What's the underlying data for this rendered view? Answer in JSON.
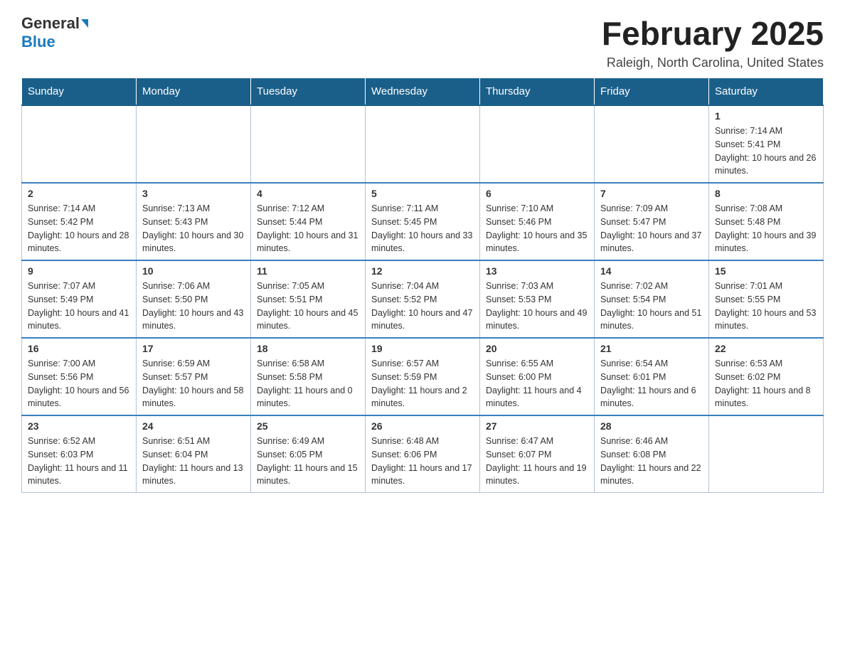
{
  "header": {
    "logo_general": "General",
    "logo_blue": "Blue",
    "month_title": "February 2025",
    "location": "Raleigh, North Carolina, United States"
  },
  "days_of_week": [
    "Sunday",
    "Monday",
    "Tuesday",
    "Wednesday",
    "Thursday",
    "Friday",
    "Saturday"
  ],
  "weeks": [
    [
      {
        "day": "",
        "info": ""
      },
      {
        "day": "",
        "info": ""
      },
      {
        "day": "",
        "info": ""
      },
      {
        "day": "",
        "info": ""
      },
      {
        "day": "",
        "info": ""
      },
      {
        "day": "",
        "info": ""
      },
      {
        "day": "1",
        "info": "Sunrise: 7:14 AM\nSunset: 5:41 PM\nDaylight: 10 hours and 26 minutes."
      }
    ],
    [
      {
        "day": "2",
        "info": "Sunrise: 7:14 AM\nSunset: 5:42 PM\nDaylight: 10 hours and 28 minutes."
      },
      {
        "day": "3",
        "info": "Sunrise: 7:13 AM\nSunset: 5:43 PM\nDaylight: 10 hours and 30 minutes."
      },
      {
        "day": "4",
        "info": "Sunrise: 7:12 AM\nSunset: 5:44 PM\nDaylight: 10 hours and 31 minutes."
      },
      {
        "day": "5",
        "info": "Sunrise: 7:11 AM\nSunset: 5:45 PM\nDaylight: 10 hours and 33 minutes."
      },
      {
        "day": "6",
        "info": "Sunrise: 7:10 AM\nSunset: 5:46 PM\nDaylight: 10 hours and 35 minutes."
      },
      {
        "day": "7",
        "info": "Sunrise: 7:09 AM\nSunset: 5:47 PM\nDaylight: 10 hours and 37 minutes."
      },
      {
        "day": "8",
        "info": "Sunrise: 7:08 AM\nSunset: 5:48 PM\nDaylight: 10 hours and 39 minutes."
      }
    ],
    [
      {
        "day": "9",
        "info": "Sunrise: 7:07 AM\nSunset: 5:49 PM\nDaylight: 10 hours and 41 minutes."
      },
      {
        "day": "10",
        "info": "Sunrise: 7:06 AM\nSunset: 5:50 PM\nDaylight: 10 hours and 43 minutes."
      },
      {
        "day": "11",
        "info": "Sunrise: 7:05 AM\nSunset: 5:51 PM\nDaylight: 10 hours and 45 minutes."
      },
      {
        "day": "12",
        "info": "Sunrise: 7:04 AM\nSunset: 5:52 PM\nDaylight: 10 hours and 47 minutes."
      },
      {
        "day": "13",
        "info": "Sunrise: 7:03 AM\nSunset: 5:53 PM\nDaylight: 10 hours and 49 minutes."
      },
      {
        "day": "14",
        "info": "Sunrise: 7:02 AM\nSunset: 5:54 PM\nDaylight: 10 hours and 51 minutes."
      },
      {
        "day": "15",
        "info": "Sunrise: 7:01 AM\nSunset: 5:55 PM\nDaylight: 10 hours and 53 minutes."
      }
    ],
    [
      {
        "day": "16",
        "info": "Sunrise: 7:00 AM\nSunset: 5:56 PM\nDaylight: 10 hours and 56 minutes."
      },
      {
        "day": "17",
        "info": "Sunrise: 6:59 AM\nSunset: 5:57 PM\nDaylight: 10 hours and 58 minutes."
      },
      {
        "day": "18",
        "info": "Sunrise: 6:58 AM\nSunset: 5:58 PM\nDaylight: 11 hours and 0 minutes."
      },
      {
        "day": "19",
        "info": "Sunrise: 6:57 AM\nSunset: 5:59 PM\nDaylight: 11 hours and 2 minutes."
      },
      {
        "day": "20",
        "info": "Sunrise: 6:55 AM\nSunset: 6:00 PM\nDaylight: 11 hours and 4 minutes."
      },
      {
        "day": "21",
        "info": "Sunrise: 6:54 AM\nSunset: 6:01 PM\nDaylight: 11 hours and 6 minutes."
      },
      {
        "day": "22",
        "info": "Sunrise: 6:53 AM\nSunset: 6:02 PM\nDaylight: 11 hours and 8 minutes."
      }
    ],
    [
      {
        "day": "23",
        "info": "Sunrise: 6:52 AM\nSunset: 6:03 PM\nDaylight: 11 hours and 11 minutes."
      },
      {
        "day": "24",
        "info": "Sunrise: 6:51 AM\nSunset: 6:04 PM\nDaylight: 11 hours and 13 minutes."
      },
      {
        "day": "25",
        "info": "Sunrise: 6:49 AM\nSunset: 6:05 PM\nDaylight: 11 hours and 15 minutes."
      },
      {
        "day": "26",
        "info": "Sunrise: 6:48 AM\nSunset: 6:06 PM\nDaylight: 11 hours and 17 minutes."
      },
      {
        "day": "27",
        "info": "Sunrise: 6:47 AM\nSunset: 6:07 PM\nDaylight: 11 hours and 19 minutes."
      },
      {
        "day": "28",
        "info": "Sunrise: 6:46 AM\nSunset: 6:08 PM\nDaylight: 11 hours and 22 minutes."
      },
      {
        "day": "",
        "info": ""
      }
    ]
  ]
}
